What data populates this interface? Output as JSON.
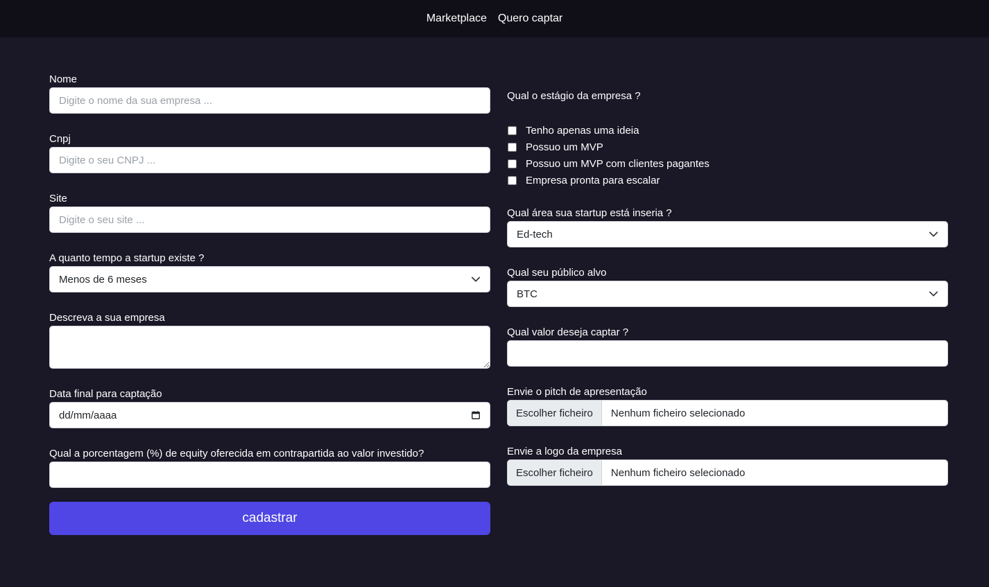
{
  "nav": {
    "links": [
      "Marketplace",
      "Quero captar"
    ]
  },
  "form_left": {
    "nome_label": "Nome",
    "nome_placeholder": "Digite o nome da sua empresa ...",
    "cnpj_label": "Cnpj",
    "cnpj_placeholder": "Digite o seu CNPJ ...",
    "site_label": "Site",
    "site_placeholder": "Digite o seu site ...",
    "tempo_label": "A quanto tempo a startup existe ?",
    "tempo_value": "Menos de 6 meses",
    "descricao_label": "Descreva a sua empresa",
    "data_label": "Data final para captação",
    "data_value": "dd/mm/aaaa",
    "equity_label": "Qual a porcentagem (%) de equity oferecida em contrapartida ao valor investido?",
    "submit_label": "cadastrar"
  },
  "form_right": {
    "estagio_label": "Qual o estágio da empresa ?",
    "estagio_options": [
      "Tenho apenas uma ideia",
      "Possuo um MVP",
      "Possuo um MVP com clientes pagantes",
      "Empresa pronta para escalar"
    ],
    "area_label": "Qual área sua startup está inseria ?",
    "area_value": "Ed-tech",
    "publico_label": "Qual seu público alvo",
    "publico_value": "BTC",
    "valor_label": "Qual valor deseja captar ?",
    "pitch_label": "Envie o pitch de apresentação",
    "logo_label": "Envie a logo da empresa",
    "file_button": "Escolher ficheiro",
    "file_none": "Nenhum ficheiro selecionado"
  },
  "colors": {
    "background": "#1a1726",
    "navbar": "#100f18",
    "accent": "#4f46e5"
  }
}
